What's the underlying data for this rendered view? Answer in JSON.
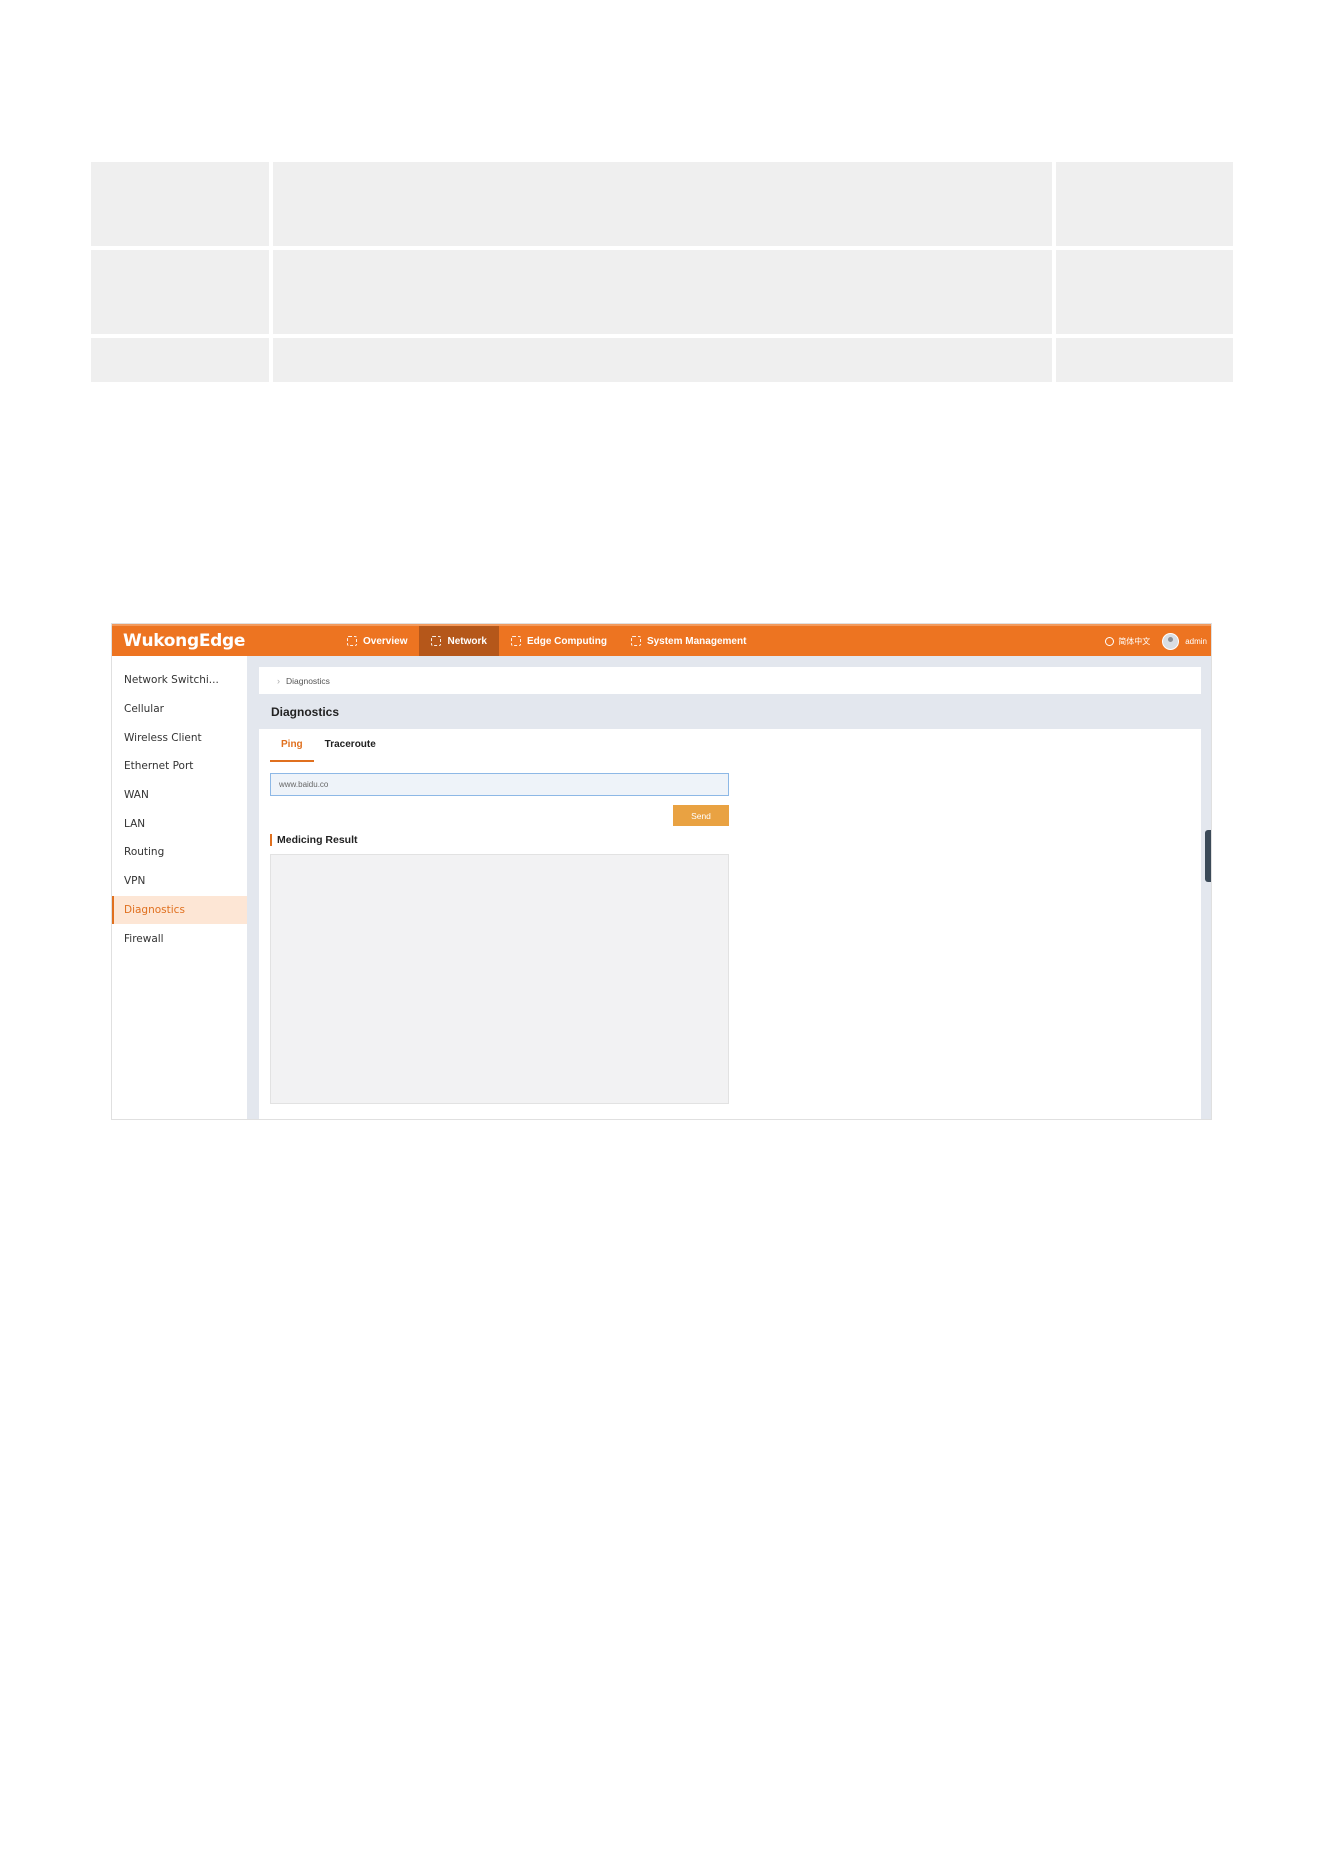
{
  "app": {
    "logo": "WukongEdge",
    "nav": [
      {
        "label": "Overview",
        "active": false
      },
      {
        "label": "Network",
        "active": true
      },
      {
        "label": "Edge Computing",
        "active": false
      },
      {
        "label": "System Management",
        "active": false
      }
    ],
    "language": "简体中文",
    "user": "admin"
  },
  "sidebar": {
    "items": [
      {
        "label": "Network Switchi...",
        "active": false
      },
      {
        "label": "Cellular",
        "active": false
      },
      {
        "label": "Wireless Client",
        "active": false
      },
      {
        "label": "Ethernet Port",
        "active": false
      },
      {
        "label": "WAN",
        "active": false
      },
      {
        "label": "LAN",
        "active": false
      },
      {
        "label": "Routing",
        "active": false
      },
      {
        "label": "VPN",
        "active": false
      },
      {
        "label": "Diagnostics",
        "active": true
      },
      {
        "label": "Firewall",
        "active": false
      }
    ]
  },
  "breadcrumb": "Diagnostics",
  "page_title": "Diagnostics",
  "tabs": [
    {
      "label": "Ping",
      "active": true
    },
    {
      "label": "Traceroute",
      "active": false
    }
  ],
  "ping": {
    "host_value": "www.baidu.co",
    "send_label": "Send",
    "result_title": "Medicing Result"
  },
  "colors": {
    "brand": "#ed7421",
    "nav_active": "#b5571a",
    "send_button": "#e9a242",
    "accent": "#e0701f"
  }
}
